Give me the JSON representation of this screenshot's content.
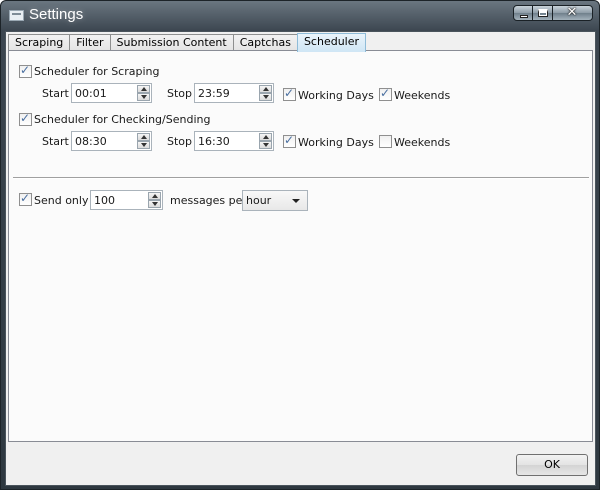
{
  "window": {
    "title": "Settings",
    "controls": {
      "minimize": "minimize",
      "maximize": "maximize",
      "close": "✕"
    }
  },
  "tabs": [
    {
      "label": "Scraping",
      "active": false
    },
    {
      "label": "Filter",
      "active": false
    },
    {
      "label": "Submission Content",
      "active": false
    },
    {
      "label": "Captchas",
      "active": false
    },
    {
      "label": "Scheduler",
      "active": true
    }
  ],
  "scheduler": {
    "scraping": {
      "label": "Scheduler for Scraping",
      "checked": true,
      "start_label": "Start",
      "start_value": "00:01",
      "stop_label": "Stop",
      "stop_value": "23:59",
      "working_days_label": "Working Days",
      "working_days_checked": true,
      "weekends_label": "Weekends",
      "weekends_checked": true
    },
    "checking": {
      "label": "Scheduler for Checking/Sending",
      "checked": true,
      "start_label": "Start",
      "start_value": "08:30",
      "stop_label": "Stop",
      "stop_value": "16:30",
      "working_days_label": "Working Days",
      "working_days_checked": true,
      "weekends_label": "Weekends",
      "weekends_checked": false
    },
    "send_only": {
      "label": "Send only",
      "checked": true,
      "value": "100",
      "per_label": "messages per",
      "period_value": "hour"
    }
  },
  "footer": {
    "ok_label": "OK"
  },
  "colors": {
    "accent_tab": "#cfe6f5",
    "check_mark": "#4a6fa0",
    "title_bar": "#3c4650"
  }
}
